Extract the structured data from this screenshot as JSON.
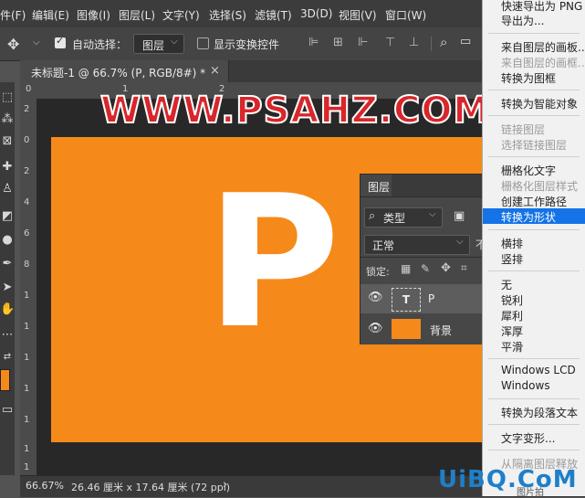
{
  "menubar": {
    "items": [
      "件(F)",
      "编辑(E)",
      "图像(I)",
      "图层(L)",
      "文字(Y)",
      "选择(S)",
      "滤镜(T)",
      "3D(D)",
      "视图(V)",
      "窗口(W)"
    ]
  },
  "options": {
    "auto_select_label": "自动选择：",
    "layer_select_value": "图层",
    "show_transform_label": "显示变换控件"
  },
  "document": {
    "tab_title": "未标题-1 @ 66.7% (P, RGB/8#) *",
    "close_glyph": "×",
    "artboard_letter": "P",
    "artboard_color": "#f58a1a"
  },
  "ruler": {
    "top_marks": [
      "0",
      "1",
      "2"
    ],
    "left_marks": [
      "2",
      "0",
      "2",
      "4",
      "6",
      "8",
      "1",
      "1",
      "1",
      "1",
      "1",
      "1",
      "1"
    ]
  },
  "watermark": "WWW.PSAHZ.COM",
  "watermark_bottom": "UiBQ.CoM",
  "watermark_bottom_small": "图片拍",
  "status": {
    "zoom": "66.67%",
    "doc_info": "26.46 厘米 x 17.64 厘米 (72 ppi)",
    "arrow": "›"
  },
  "layers_panel": {
    "tab": "图层",
    "filter_label": "类型",
    "blend_mode": "正常",
    "lock_label": "锁定:",
    "layers": [
      {
        "name": "P",
        "thumb": "T"
      },
      {
        "name": "背景"
      }
    ]
  },
  "context_menu": {
    "items": [
      {
        "label": "快速导出为 PNG",
        "enabled": true
      },
      {
        "label": "导出为...",
        "enabled": true
      },
      {
        "label": "来自图层的画板...",
        "enabled": true
      },
      {
        "label": "来自图层的画框...",
        "enabled": false
      },
      {
        "label": "转换为图框",
        "enabled": true
      },
      {
        "label": "转换为智能对象",
        "enabled": true
      },
      {
        "label": "链接图层",
        "enabled": false
      },
      {
        "label": "选择链接图层",
        "enabled": false
      },
      {
        "label": "栅格化文字",
        "enabled": true
      },
      {
        "label": "栅格化图层样式",
        "enabled": false
      },
      {
        "label": "创建工作路径",
        "enabled": true
      },
      {
        "label": "转换为形状",
        "enabled": true,
        "highlighted": true
      },
      {
        "label": "横排",
        "enabled": true
      },
      {
        "label": "竖排",
        "enabled": true
      },
      {
        "label": "无",
        "enabled": true
      },
      {
        "label": "锐利",
        "enabled": true
      },
      {
        "label": "犀利",
        "enabled": true
      },
      {
        "label": "浑厚",
        "enabled": true
      },
      {
        "label": "平滑",
        "enabled": true
      },
      {
        "label": "Windows LCD",
        "enabled": true
      },
      {
        "label": "Windows",
        "enabled": true
      },
      {
        "label": "转换为段落文本",
        "enabled": true
      },
      {
        "label": "文字变形...",
        "enabled": true
      },
      {
        "label": "从隔离图层释放",
        "enabled": false
      }
    ],
    "highlight_color": "#1473e6"
  },
  "colors": {
    "foreground_swatch": "#f58a1a"
  }
}
